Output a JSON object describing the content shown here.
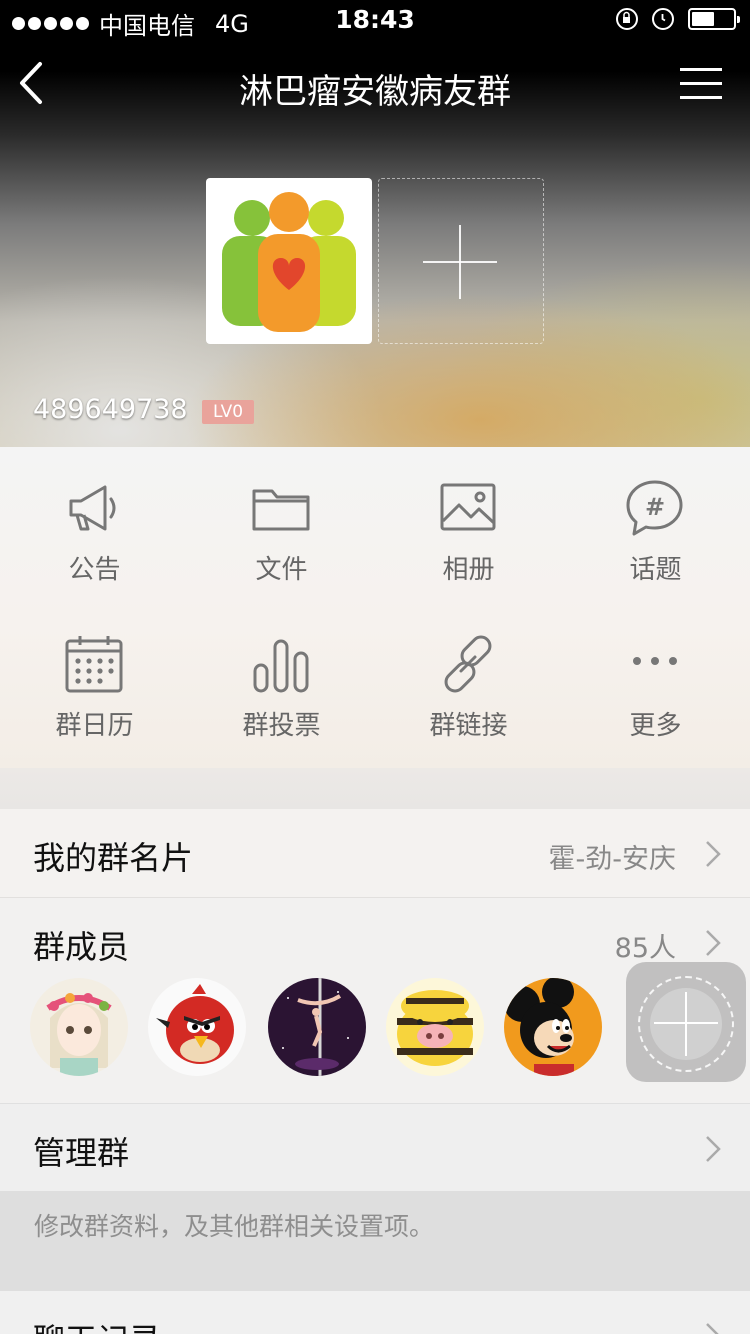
{
  "status": {
    "carrier": "中国电信",
    "network": "4G",
    "time": "18:43"
  },
  "nav": {
    "title": "淋巴瘤安徽病友群"
  },
  "group": {
    "id": "489649738",
    "level": "LV0"
  },
  "functions": [
    {
      "label": "公告",
      "icon": "megaphone-icon"
    },
    {
      "label": "文件",
      "icon": "folder-icon"
    },
    {
      "label": "相册",
      "icon": "photo-icon"
    },
    {
      "label": "话题",
      "icon": "hashtag-icon"
    },
    {
      "label": "群日历",
      "icon": "calendar-icon"
    },
    {
      "label": "群投票",
      "icon": "vote-icon"
    },
    {
      "label": "群链接",
      "icon": "link-icon"
    },
    {
      "label": "更多",
      "icon": "more-icon"
    }
  ],
  "card": {
    "title": "我的群名片",
    "value": "霍-劲-安庆"
  },
  "members": {
    "title": "群成员",
    "count": "85人",
    "avatars": [
      "flower-girl-avatar",
      "angry-bird-avatar",
      "pole-dancer-avatar",
      "bee-pig-avatar",
      "mickey-avatar"
    ]
  },
  "manage": {
    "title": "管理群",
    "description": "修改群资料，及其他群相关设置项。"
  },
  "history": {
    "title": "聊天记录"
  }
}
